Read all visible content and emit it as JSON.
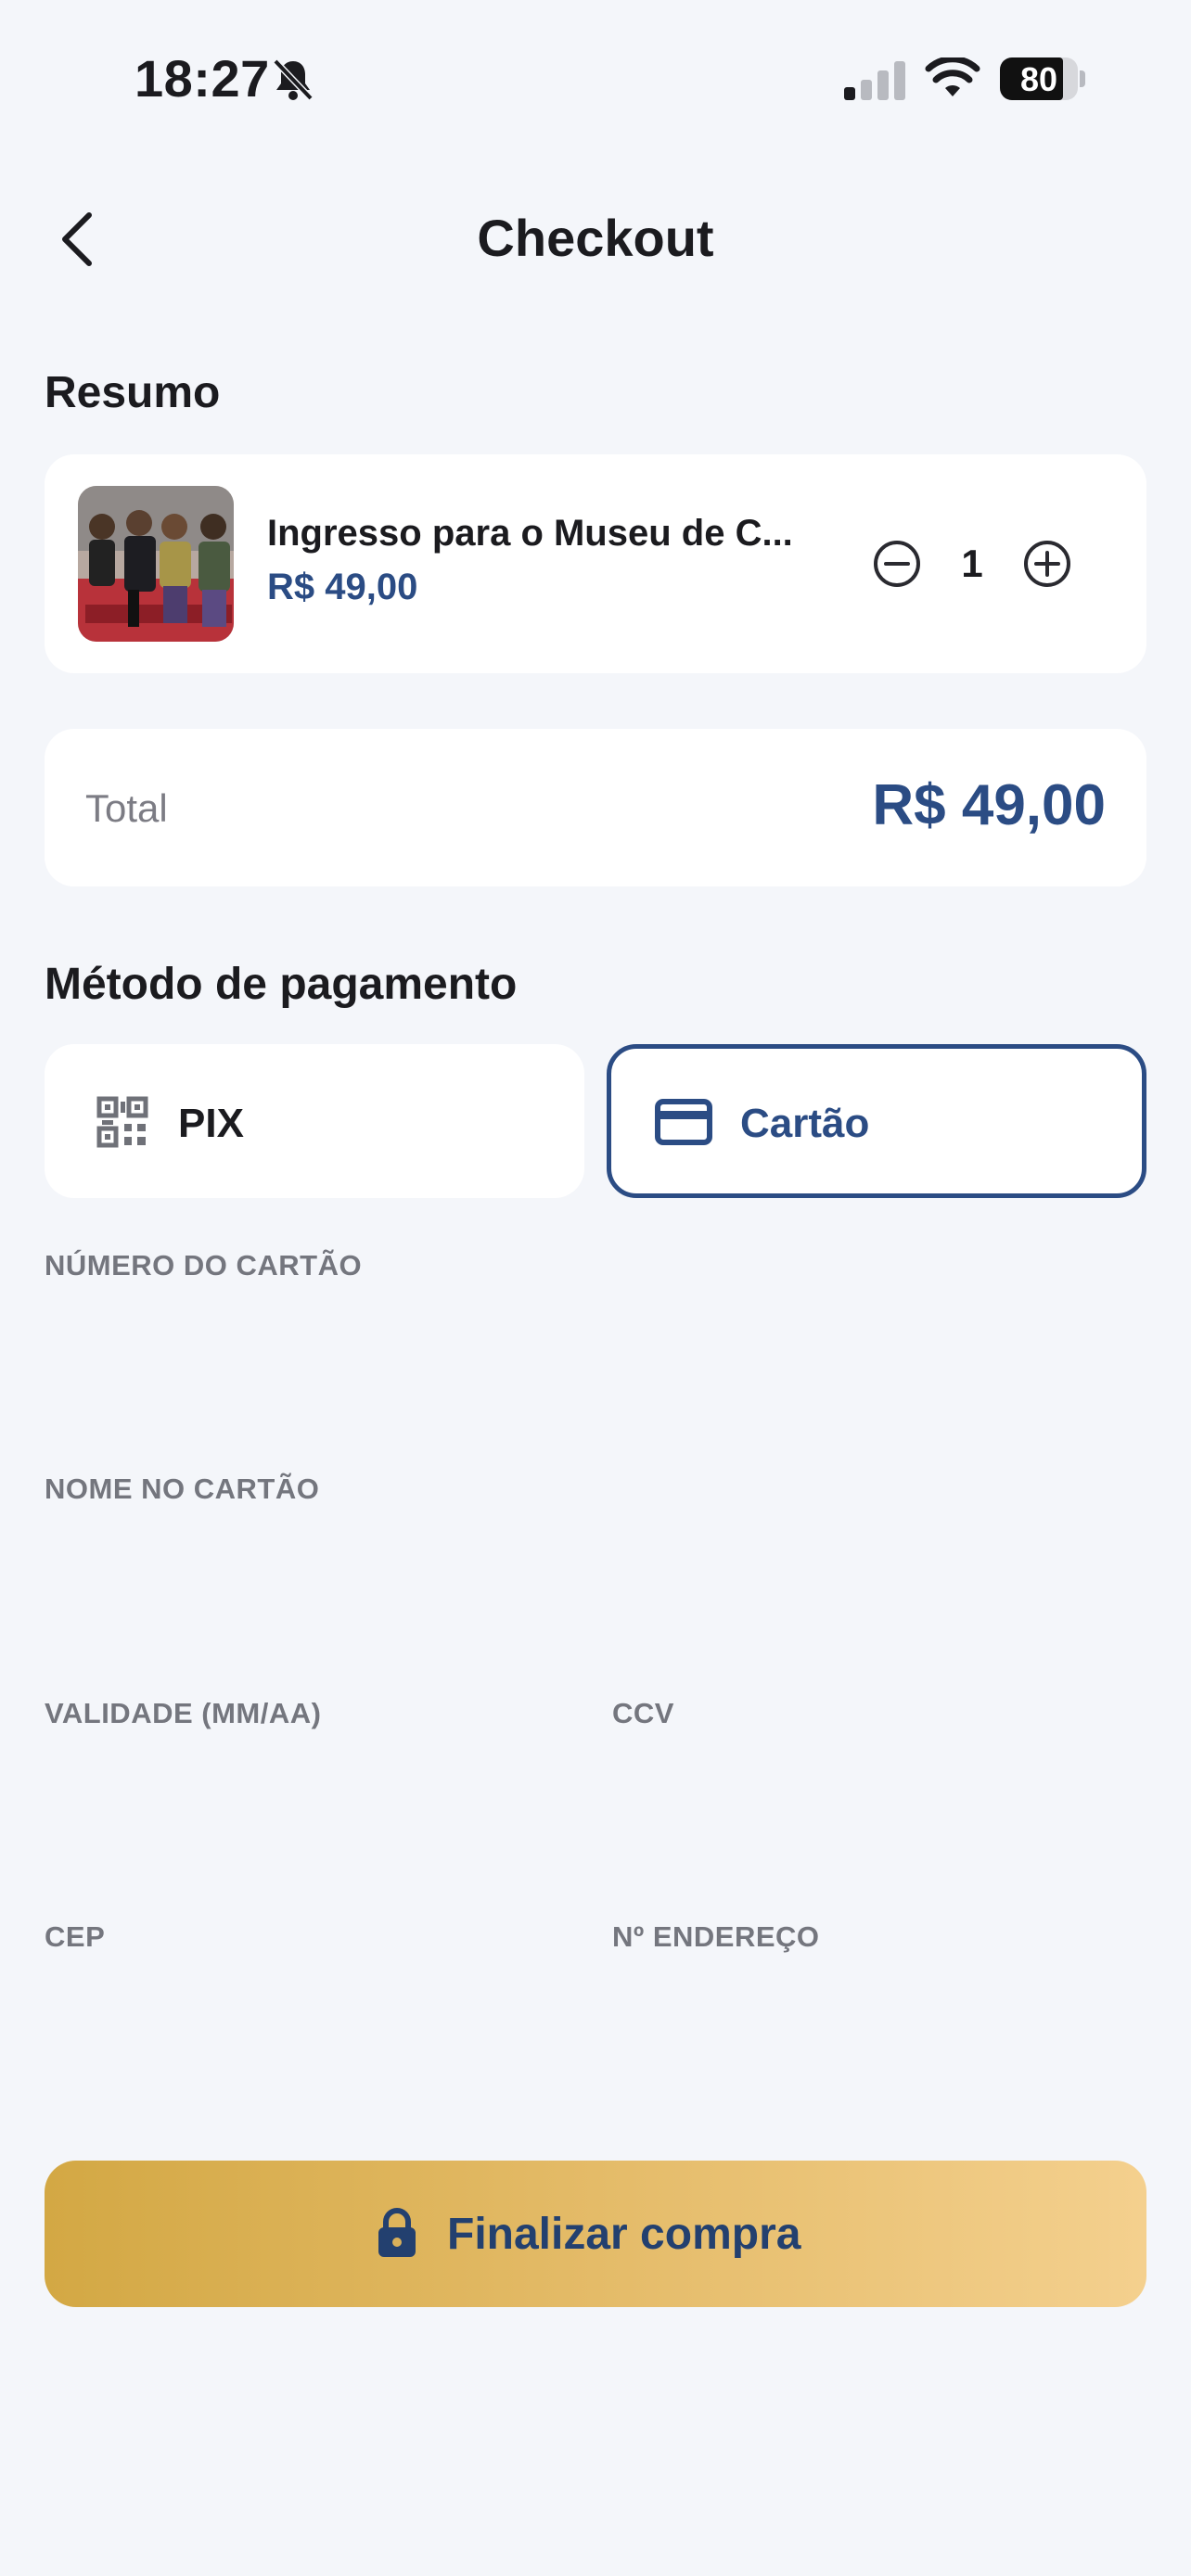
{
  "status_bar": {
    "time": "18:27",
    "battery": "80",
    "icons": [
      "bell-slash-icon",
      "signal-icon",
      "wifi-icon",
      "battery-icon"
    ]
  },
  "header": {
    "title": "Checkout",
    "back_icon": "chevron-left-icon"
  },
  "summary": {
    "title": "Resumo",
    "item": {
      "name": "Ingresso para o Museu de C...",
      "price": "R$ 49,00",
      "quantity": "1"
    },
    "total_label": "Total",
    "total_value": "R$ 49,00"
  },
  "payment": {
    "title": "Método de pagamento",
    "options": [
      {
        "label": "PIX",
        "icon": "qr-code-icon",
        "selected": false
      },
      {
        "label": "Cartão",
        "icon": "credit-card-icon",
        "selected": true
      }
    ],
    "fields": {
      "card_number": "NÚMERO DO CARTÃO",
      "card_name": "NOME NO CARTÃO",
      "expiry": "VALIDADE (MM/AA)",
      "ccv": "CCV",
      "cep": "CEP",
      "address_number": "Nº ENDEREÇO"
    }
  },
  "submit": {
    "label": "Finalizar compra",
    "icon": "lock-icon"
  },
  "colors": {
    "background": "#f4f6fa",
    "accent": "#2b4c84",
    "button_gradient_start": "#d3a844",
    "button_gradient_end": "#f4d08e"
  }
}
